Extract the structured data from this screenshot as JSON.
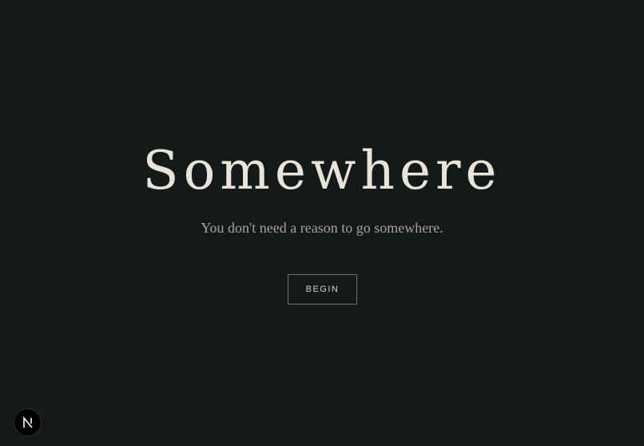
{
  "hero": {
    "title": "Somewhere",
    "subtitle": "You don't need a reason to go somewhere.",
    "cta_label": "BEGIN"
  },
  "dev_indicator": {
    "icon": "nextjs-logo-icon"
  },
  "colors": {
    "background": "#141a1a",
    "title": "#e9e4d8",
    "subtitle": "#a7a398",
    "button_border": "#6f736d"
  }
}
